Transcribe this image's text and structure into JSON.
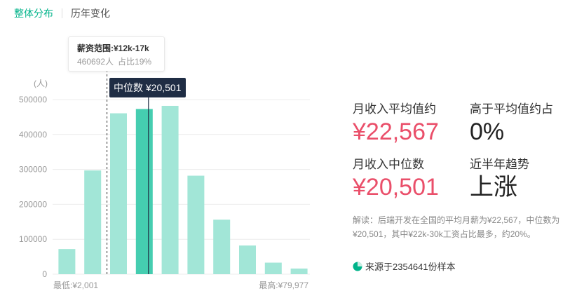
{
  "tabs": [
    {
      "label": "整体分布",
      "active": true
    },
    {
      "label": "历年变化",
      "active": false
    }
  ],
  "chart_data": {
    "type": "bar",
    "unit_label": "(人)",
    "y_ticks": [
      "0",
      "100000",
      "200000",
      "300000",
      "400000",
      "500000"
    ],
    "ylim": [
      0,
      500000
    ],
    "grid": true,
    "values": [
      72000,
      297000,
      460692,
      473000,
      482000,
      282000,
      156000,
      82000,
      33000,
      16000
    ],
    "highlight_index": 3,
    "min_label": "最低:¥2,001",
    "max_label": "最高:¥79,977",
    "tooltip": {
      "title": "薪资范围:¥12k-17k",
      "count": "460692人",
      "share": "占比19%",
      "bar_index": 2
    },
    "median_label": "中位数 ¥20,501",
    "median_position": 3.5
  },
  "stats": {
    "avg_label": "月收入平均值约",
    "avg_value": "¥22,567",
    "above_label": "高于平均值约占",
    "above_value": "0%",
    "median_title": "月收入中位数",
    "median_value": "¥20,501",
    "trend_label": "近半年趋势",
    "trend_value": "上涨"
  },
  "interpretation": "解读：后端开发在全国的平均月薪为¥22,567，中位数为¥20,501，其中¥22k-30k工资占比最多，约20%。",
  "source": "来源于2354641份样本",
  "colors": {
    "accent": "#00b38a",
    "bar": "#a2e6d7",
    "bar_highlight": "#45cdb0",
    "money": "#ea4f6a",
    "median_bg": "#1f2d44"
  }
}
